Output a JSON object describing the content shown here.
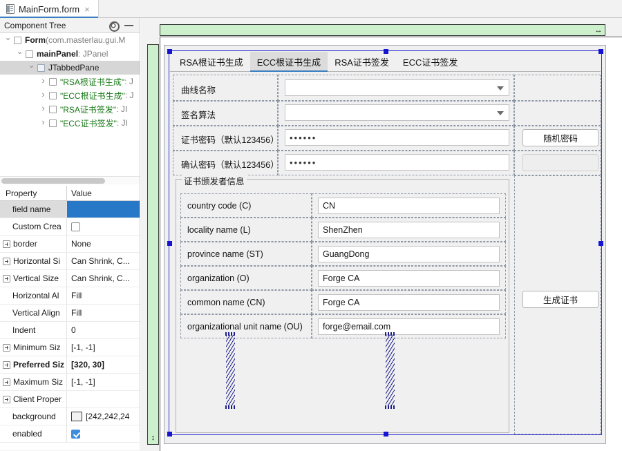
{
  "editor": {
    "tab_title": "MainForm.form",
    "close_label": "×",
    "file_icon": "form-file-icon"
  },
  "tool_window": {
    "title": "Component Tree",
    "settings_icon": "gear-icon",
    "minimize_icon": "minimize-icon"
  },
  "component_tree": {
    "rows": [
      {
        "label": "Form",
        "type": " (com.masterlau.gui.M",
        "bold": true,
        "quoted": false,
        "indent": 0,
        "twisty": "open",
        "selected": false
      },
      {
        "label": "mainPanel",
        "type": " : JPanel",
        "bold": true,
        "quoted": false,
        "indent": 1,
        "twisty": "open",
        "selected": false
      },
      {
        "label": "JTabbedPane",
        "type": "",
        "bold": false,
        "quoted": false,
        "indent": 2,
        "twisty": "open",
        "selected": true
      },
      {
        "label": "\"RSA根证书生成\"",
        "type": " : J",
        "bold": false,
        "quoted": true,
        "indent": 3,
        "twisty": "closed",
        "selected": false
      },
      {
        "label": "\"ECC根证书生成\"",
        "type": " : J",
        "bold": false,
        "quoted": true,
        "indent": 3,
        "twisty": "closed",
        "selected": false
      },
      {
        "label": "\"RSA证书签发\"",
        "type": " : JI",
        "bold": false,
        "quoted": true,
        "indent": 3,
        "twisty": "closed",
        "selected": false
      },
      {
        "label": "\"ECC证书签发\"",
        "type": " : JI",
        "bold": false,
        "quoted": true,
        "indent": 3,
        "twisty": "closed",
        "selected": false
      }
    ]
  },
  "properties": {
    "header": {
      "name": "Property",
      "value": "Value"
    },
    "rows": [
      {
        "name": "field name",
        "value": "",
        "kind": "text",
        "selected": true,
        "expandable": false,
        "bold": false,
        "indent": true
      },
      {
        "name": "Custom Crea",
        "value": "",
        "kind": "checkbox",
        "checked": false,
        "selected": false,
        "expandable": false,
        "bold": false,
        "indent": true
      },
      {
        "name": "border",
        "value": "None",
        "kind": "text",
        "selected": false,
        "expandable": true,
        "bold": false,
        "indent": false
      },
      {
        "name": "Horizontal Si",
        "value": "Can Shrink, C...",
        "kind": "text",
        "selected": false,
        "expandable": true,
        "bold": false,
        "indent": false
      },
      {
        "name": "Vertical Size ",
        "value": "Can Shrink, C...",
        "kind": "text",
        "selected": false,
        "expandable": true,
        "bold": false,
        "indent": false
      },
      {
        "name": "Horizontal Al",
        "value": "Fill",
        "kind": "text",
        "selected": false,
        "expandable": false,
        "bold": false,
        "indent": true
      },
      {
        "name": "Vertical Align",
        "value": "Fill",
        "kind": "text",
        "selected": false,
        "expandable": false,
        "bold": false,
        "indent": true
      },
      {
        "name": "Indent",
        "value": "0",
        "kind": "text",
        "selected": false,
        "expandable": false,
        "bold": false,
        "indent": true
      },
      {
        "name": "Minimum Siz",
        "value": "[-1, -1]",
        "kind": "text",
        "selected": false,
        "expandable": true,
        "bold": false,
        "indent": false
      },
      {
        "name": "Preferred Siz",
        "value": "[320, 30]",
        "kind": "text",
        "selected": false,
        "expandable": true,
        "bold": true,
        "indent": false
      },
      {
        "name": "Maximum Siz",
        "value": "[-1, -1]",
        "kind": "text",
        "selected": false,
        "expandable": true,
        "bold": false,
        "indent": false
      },
      {
        "name": "Client Proper",
        "value": "",
        "kind": "text",
        "selected": false,
        "expandable": true,
        "bold": false,
        "indent": false
      },
      {
        "name": "background",
        "value": "[242,242,24",
        "kind": "color",
        "swatch": "#f2f2f2",
        "selected": false,
        "expandable": false,
        "bold": false,
        "indent": true
      },
      {
        "name": "enabled",
        "value": "",
        "kind": "checkbox",
        "checked": true,
        "selected": false,
        "expandable": false,
        "bold": false,
        "indent": true
      }
    ]
  },
  "designer": {
    "ruler_horizontal_handle": "horizontal-resize-icon",
    "ruler_vertical_handle": "vertical-resize-icon",
    "ruler_color": "#ccf0cc",
    "selection_color": "#1414d2"
  },
  "form": {
    "tabs": [
      {
        "label": "RSA根证书生成",
        "active": false
      },
      {
        "label": "ECC根证书生成",
        "active": true
      },
      {
        "label": "RSA证书签发",
        "active": false
      },
      {
        "label": "ECC证书签发",
        "active": false
      }
    ],
    "fields": {
      "curve_name_label": "曲线名称",
      "curve_name_value": "",
      "sign_algo_label": "签名算法",
      "sign_algo_value": "",
      "cert_password_label": "证书密码（默认123456）",
      "cert_password_value": "••••••",
      "confirm_password_label": "确认密码（默认123456）",
      "confirm_password_value": "••••••"
    },
    "buttons": {
      "random_password": "随机密码",
      "generate_cert": "生成证书"
    },
    "issuer_group": {
      "title": "证书颁发者信息",
      "rows": [
        {
          "label": "country code (C)",
          "value": "CN"
        },
        {
          "label": "locality name (L)",
          "value": "ShenZhen"
        },
        {
          "label": "province name (ST)",
          "value": "GuangDong"
        },
        {
          "label": "organization (O)",
          "value": "Forge CA"
        },
        {
          "label": "common name (CN)",
          "value": "Forge CA"
        },
        {
          "label": "organizational unit name (OU)",
          "value": "forge@email.com"
        }
      ]
    }
  }
}
